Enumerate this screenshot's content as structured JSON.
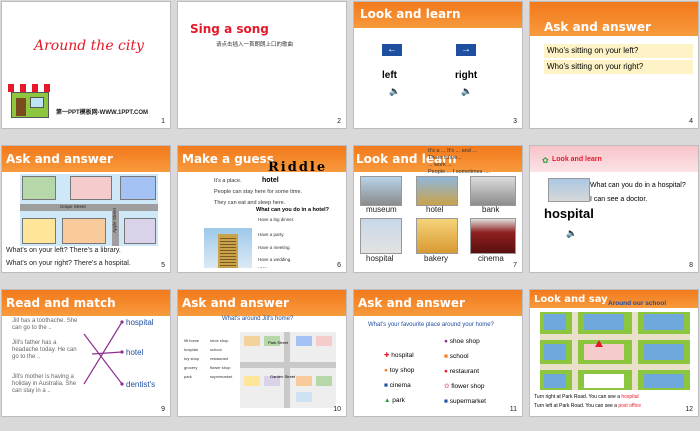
{
  "slides": [
    {
      "num": "1",
      "title": "Around the city",
      "site": "第一PPT模板网-WWW.1PPT.COM"
    },
    {
      "num": "2",
      "title": "Sing a song",
      "subtitle": "请点击插入一首朗朗上口的歌曲"
    },
    {
      "num": "3",
      "title": "Look and learn",
      "left": "left",
      "right": "right"
    },
    {
      "num": "4",
      "title": "Ask and answer",
      "q1": "Who's sitting on your left?",
      "q2": "Who's sitting on your right?"
    },
    {
      "num": "5",
      "title": "Ask and answer",
      "grape": "Grape Street",
      "apple": "Apple Street",
      "line1": "What's on your left? There's a library.",
      "line2": "What's on your right? There's a hospital."
    },
    {
      "num": "6",
      "title": "Make a guess",
      "riddle": "Riddle",
      "hotel": "hotel",
      "t1": "It's a place.",
      "t2": "People can stay here for some time.",
      "t3": "They can eat and sleep here.",
      "q": "What can you do in a hotel?",
      "a1": "Have a big dinner.",
      "a2": "Have a party.",
      "a3": "Have a meeting.",
      "a4": "Have a wedding.",
      "dots": "......"
    },
    {
      "num": "7",
      "title": "Look and learn",
      "p1": "It's a ... It's ... and ...",
      "p2": "There is/are...",
      "p3": "... work ...",
      "p4": "People ... I sometimes ....",
      "labels": [
        "museum",
        "hotel",
        "bank",
        "hospital",
        "bakery",
        "cinema"
      ]
    },
    {
      "num": "8",
      "title": "Look and learn",
      "q": "What can you do in a hospital?",
      "a": "I can see a doctor.",
      "word": "hospital"
    },
    {
      "num": "9",
      "title": "Read and match",
      "s1": "Jill has a toothache. She can go to the ..",
      "s2": "Jill's father has a headache today. He can go to the ..",
      "s3": "Jill's mother is having a holiday in Australia. She can stay in a ..",
      "w1": "hospital",
      "w2": "hotel",
      "w3": "dentist's"
    },
    {
      "num": "10",
      "title": "Ask and answer",
      "q": "What's around Jill's home?",
      "items": [
        "lift home",
        "hospital",
        "toy shop",
        "grocery",
        "park"
      ],
      "items2": [
        "shoe shop",
        "school",
        "restaurant",
        "flower shop",
        "supermarket"
      ],
      "park": "Park Street",
      "garden": "Garden Street"
    },
    {
      "num": "11",
      "title": "Ask and answer",
      "q": "What's your favourite place around your home?",
      "col1": [
        "hospital",
        "toy shop",
        "cinema",
        "park"
      ],
      "col2": [
        "shoe shop",
        "school",
        "restaurant",
        "flower shop",
        "supermarket"
      ]
    },
    {
      "num": "12",
      "title": "Look and say",
      "sub": "Around our school",
      "l1": "Turn right at Park Road. You can see a ",
      "h1": "hospital",
      "l2": "Turn left at Park Road. You can see a ",
      "h2": "post office"
    }
  ],
  "colors": {
    "orange": "#f2791b",
    "red": "#e5192a",
    "pink": "#f7c3c8",
    "blue": "#1e4fa0"
  }
}
